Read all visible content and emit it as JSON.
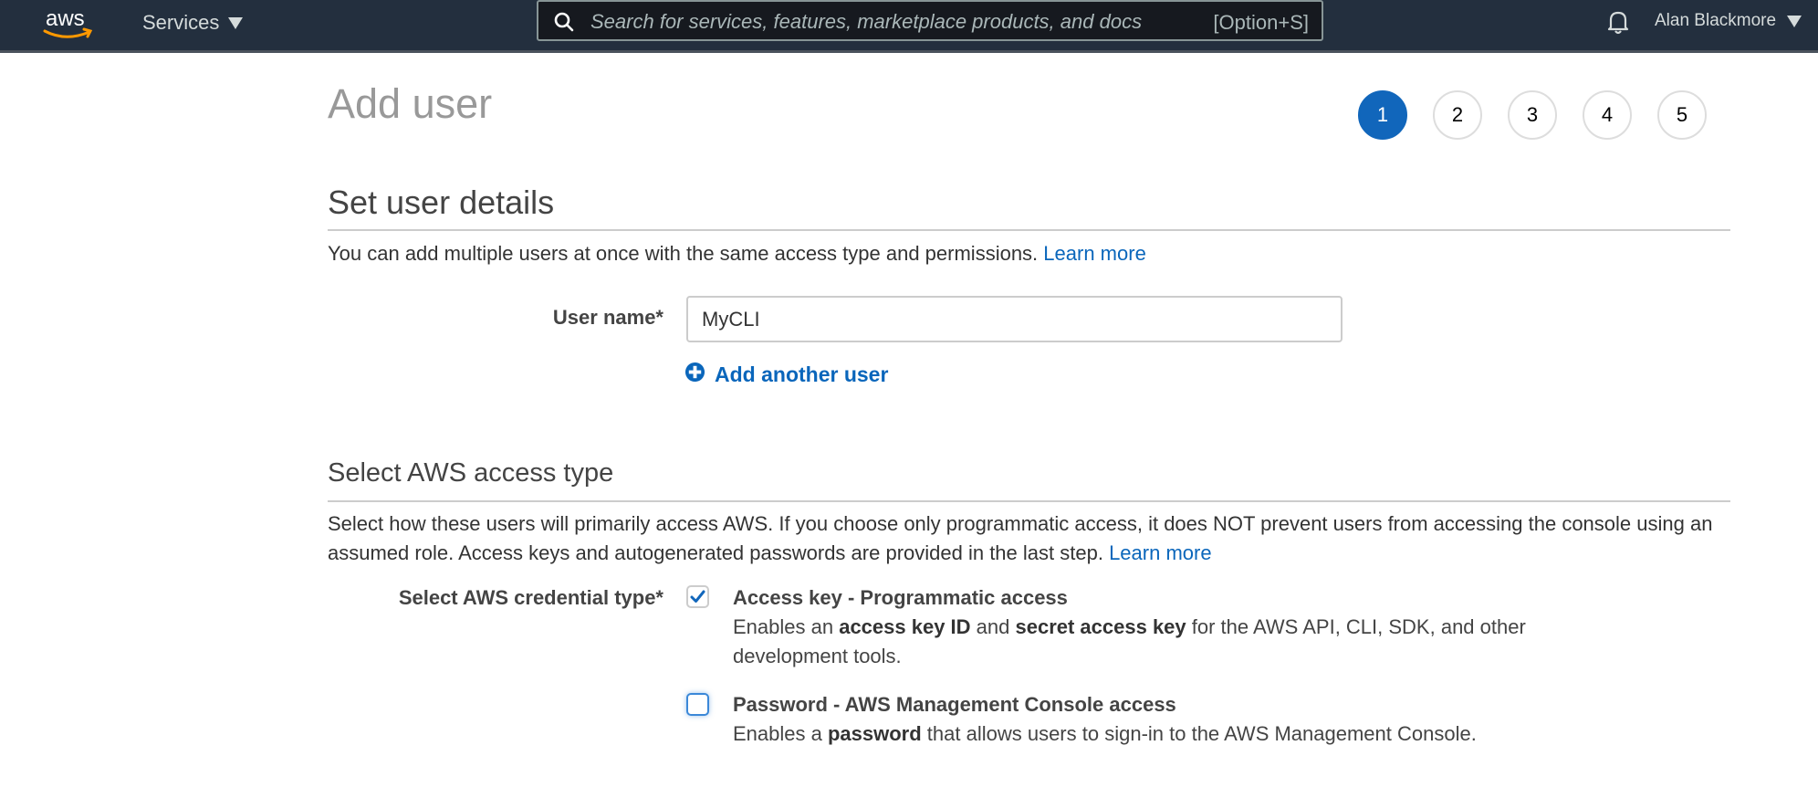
{
  "nav": {
    "logo": "aws",
    "services_label": "Services",
    "search_placeholder": "Search for services, features, marketplace products, and docs",
    "search_shortcut": "[Option+S]",
    "user_name": "Alan Blackmore",
    "icons": {
      "search": "search-icon",
      "bell": "bell-icon",
      "caret": "caret-down-icon"
    }
  },
  "page": {
    "title": "Add user",
    "steps": [
      {
        "label": "1",
        "active": true
      },
      {
        "label": "2",
        "active": false
      },
      {
        "label": "3",
        "active": false
      },
      {
        "label": "4",
        "active": false
      },
      {
        "label": "5",
        "active": false
      }
    ]
  },
  "user_details": {
    "heading": "Set user details",
    "description": "You can add multiple users at once with the same access type and permissions.",
    "learn_more": "Learn more",
    "username_label": "User name*",
    "username_value": "MyCLI",
    "add_another": "Add another user"
  },
  "access_type": {
    "heading": "Select AWS access type",
    "description": "Select how these users will primarily access AWS. If you choose only programmatic access, it does NOT prevent users from accessing the console using an assumed role. Access keys and autogenerated passwords are provided in the last step.",
    "learn_more": "Learn more",
    "credential_label": "Select AWS credential type*",
    "options": [
      {
        "title": "Access key - Programmatic access",
        "checked": true,
        "desc_parts": [
          "Enables an ",
          "access key ID",
          " and ",
          "secret access key",
          " for the AWS API, CLI, SDK, and other development tools."
        ]
      },
      {
        "title": "Password - AWS Management Console access",
        "checked": false,
        "desc_parts": [
          "Enables a ",
          "password",
          " that allows users to sign-in to the AWS Management Console."
        ]
      }
    ]
  },
  "colors": {
    "nav_bg": "#232f3e",
    "accent_blue": "#1166bb",
    "link": "#0a66bb",
    "aws_orange": "#ff9900"
  }
}
